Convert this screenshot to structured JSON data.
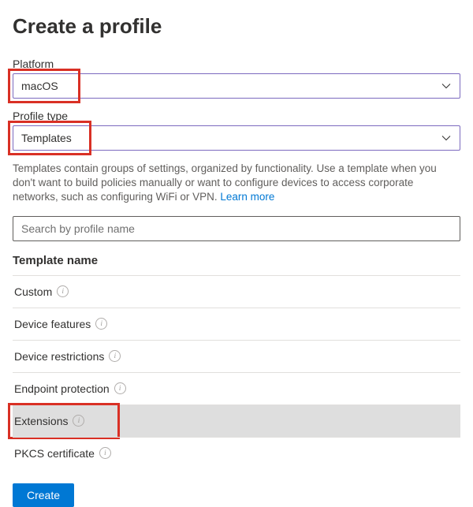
{
  "title": "Create a profile",
  "fields": {
    "platform": {
      "label": "Platform",
      "value": "macOS"
    },
    "profile_type": {
      "label": "Profile type",
      "value": "Templates"
    }
  },
  "description": {
    "text": "Templates contain groups of settings, organized by functionality. Use a template when you don't want to build policies manually or want to configure devices to access corporate networks, such as configuring WiFi or VPN. ",
    "link_label": "Learn more"
  },
  "search": {
    "placeholder": "Search by profile name"
  },
  "table": {
    "header": "Template name",
    "rows": [
      {
        "label": "Custom"
      },
      {
        "label": "Device features"
      },
      {
        "label": "Device restrictions"
      },
      {
        "label": "Endpoint protection"
      },
      {
        "label": "Extensions"
      },
      {
        "label": "PKCS certificate"
      }
    ]
  },
  "buttons": {
    "create": "Create"
  },
  "colors": {
    "accent": "#0078d4",
    "select_border": "#7c6abf",
    "highlight": "#d93025"
  }
}
